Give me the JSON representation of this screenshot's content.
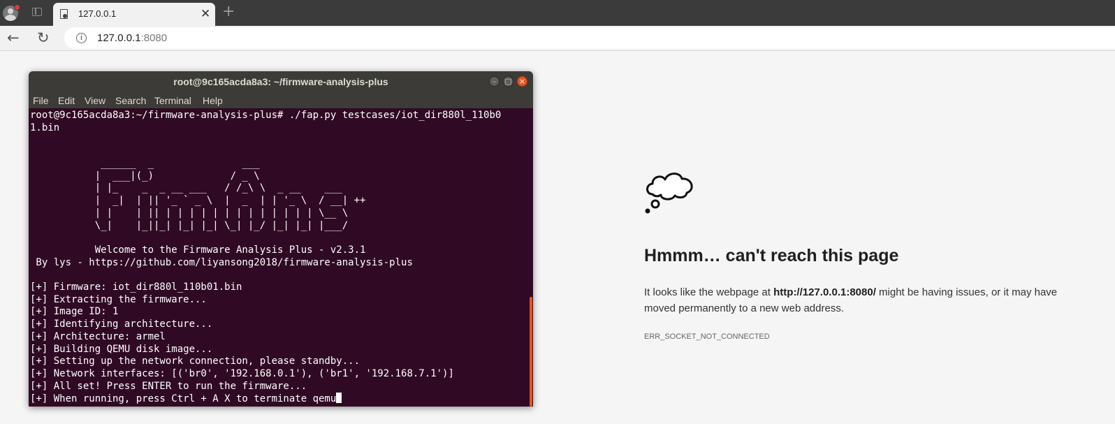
{
  "browser": {
    "tab": {
      "title": "127.0.0.1"
    },
    "url": {
      "host": "127.0.0.1",
      "port": ":8080"
    }
  },
  "error_page": {
    "title": "Hmmm… can't reach this page",
    "desc_before": "It looks like the webpage at ",
    "desc_url": "http://127.0.0.1:8080/",
    "desc_after": " might be having issues, or it may have moved permanently to a new web address.",
    "code": "ERR_SOCKET_NOT_CONNECTED"
  },
  "terminal": {
    "title": "root@9c165acda8a3: ~/firmware-analysis-plus",
    "menu": [
      "File",
      "Edit",
      "View",
      "Search",
      "Terminal",
      "Help"
    ],
    "lines": [
      "root@9c165acda8a3:~/firmware-analysis-plus# ./fap.py testcases/iot_dir880l_110b0",
      "1.bin",
      "",
      "",
      "",
      "            ______  _               ___",
      "           |  ___|(_)             / _ \\",
      "           | |_    _  _ __ ___   / /_\\ \\  _ __    ___",
      "           |  _|  | || '_ ` _ \\  |  _  | | '_ \\  / __| ++",
      "           | |    | || | | | | | | | | | | | | | \\__ \\",
      "           \\_|    |_||_| |_| |_| \\_| |_/ |_| |_| |___/",
      "",
      "           Welcome to the Firmware Analysis Plus - v2.3.1",
      " By lys - https://github.com/liyansong2018/firmware-analysis-plus",
      "",
      "[+] Firmware: iot_dir880l_110b01.bin",
      "[+] Extracting the firmware...",
      "[+] Image ID: 1",
      "[+] Identifying architecture...",
      "[+] Architecture: armel",
      "[+] Building QEMU disk image...",
      "[+] Setting up the network connection, please standby...",
      "[+] Network interfaces: [('br0', '192.168.0.1'), ('br1', '192.168.7.1')]",
      "[+] All set! Press ENTER to run the firmware...",
      "[+] When running, press Ctrl + A X to terminate qemu"
    ]
  },
  "colors": {
    "terminal_bg": "#300a24",
    "terminal_titlebar": "#3c3b37",
    "accent_orange": "#e95420",
    "browser_tabbar": "#3b3b3b"
  },
  "icons": [
    "profile-icon",
    "tab-overview-icon",
    "page-favicon-icon",
    "close-icon",
    "new-tab-icon",
    "back-icon",
    "reload-icon",
    "info-icon",
    "thought-bubble-icon"
  ]
}
